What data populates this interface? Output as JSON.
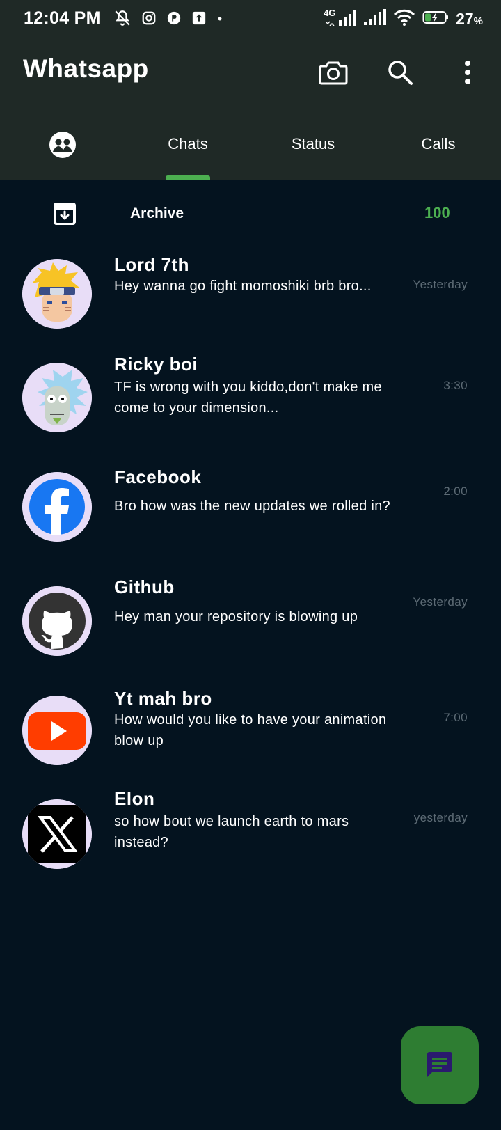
{
  "status_bar": {
    "time": "12:04 PM",
    "battery_percent": "27",
    "battery_unit": "%",
    "network_label": "4G"
  },
  "app": {
    "title": "Whatsapp"
  },
  "tabs": [
    {
      "label": "Chats",
      "active": true
    },
    {
      "label": "Status",
      "active": false
    },
    {
      "label": "Calls",
      "active": false
    }
  ],
  "archive": {
    "label": "Archive",
    "count": "100"
  },
  "chats": [
    {
      "name": "Lord 7th",
      "message": "Hey wanna go fight momoshiki brb bro...",
      "time": "Yesterday",
      "avatar_icon": "naruto-avatar"
    },
    {
      "name": "Ricky boi",
      "message": "TF is wrong with you kiddo,don't make me come to your dimension...",
      "time": "3:30",
      "avatar_icon": "rick-avatar"
    },
    {
      "name": "Facebook",
      "message": "Bro how was the new updates we rolled in?",
      "time": "2:00",
      "avatar_icon": "facebook-icon"
    },
    {
      "name": "Github",
      "message": "Hey man your repository is blowing up",
      "time": "Yesterday",
      "avatar_icon": "github-icon"
    },
    {
      "name": "Yt mah bro",
      "message": "How would you like to have your animation blow up",
      "time": "7:00",
      "avatar_icon": "youtube-icon"
    },
    {
      "name": "Elon",
      "message": "so how bout we launch earth to mars instead?",
      "time": "yesterday",
      "avatar_icon": "x-icon"
    }
  ],
  "colors": {
    "header_bg": "#1f2926",
    "body_bg": "#04131f",
    "accent_green": "#4caf50",
    "fab_bg": "#2e7d32",
    "fab_icon": "#2a1a6e"
  }
}
